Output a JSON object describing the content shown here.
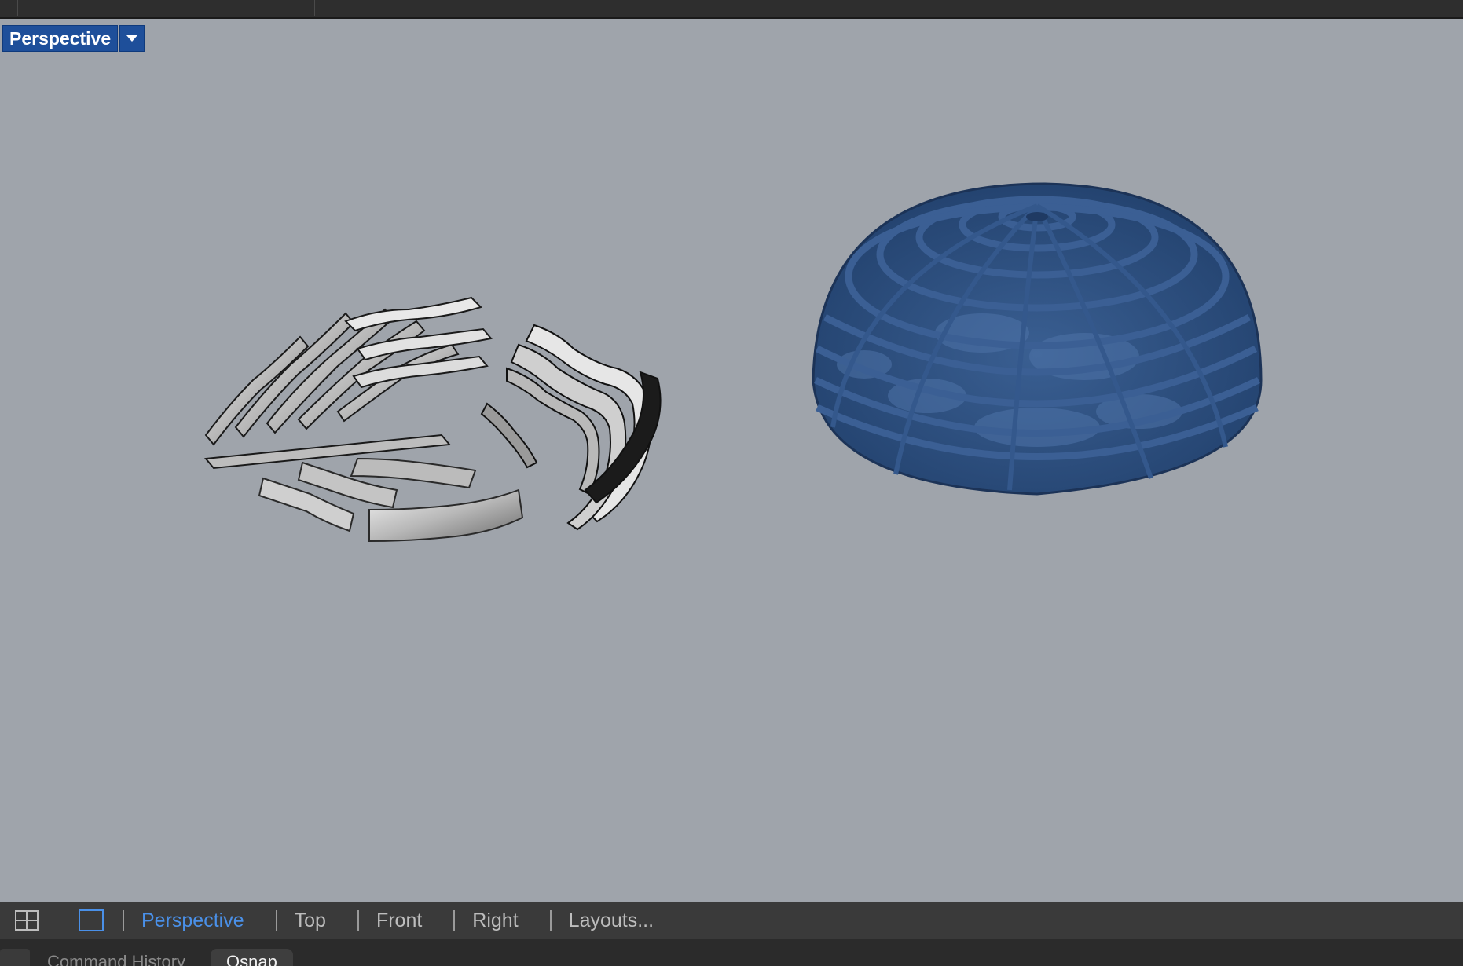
{
  "viewport": {
    "label": "Perspective",
    "background": "#9fa4ab",
    "objects": [
      {
        "name": "sliced-contour-pieces",
        "color": "#d6d6d6"
      },
      {
        "name": "ribbed-dome",
        "color": "#2d4f80"
      }
    ]
  },
  "viewport_tabs": {
    "items": [
      "Perspective",
      "Top",
      "Front",
      "Right",
      "Layouts..."
    ],
    "active": "Perspective",
    "active_color": "#4a90e8"
  },
  "command_tabs": {
    "history": "Command History",
    "osnap": "Osnap"
  },
  "icons": {
    "four_view": "four-viewports-icon",
    "single_view": "single-viewport-icon",
    "dropdown": "chevron-down-icon"
  }
}
